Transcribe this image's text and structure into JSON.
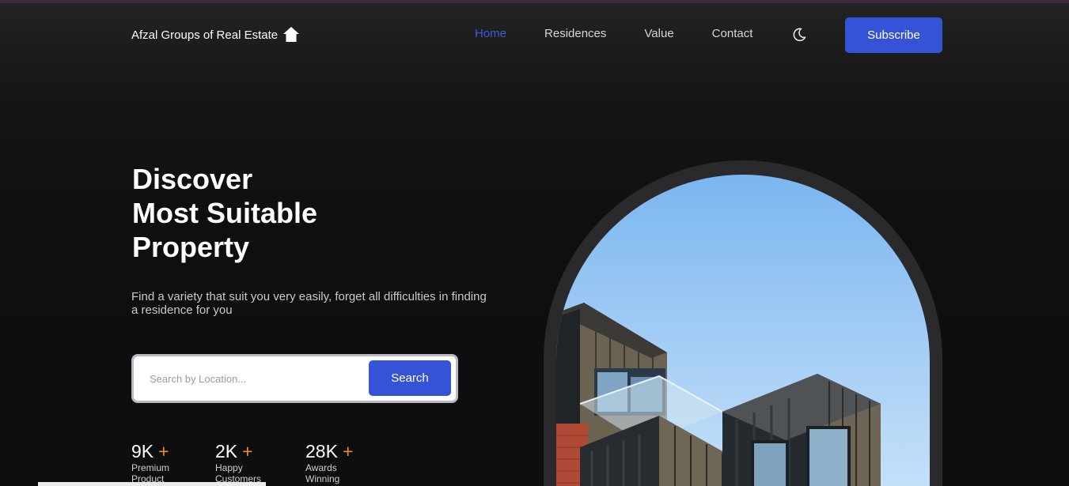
{
  "brand": {
    "name": "Afzal Groups of Real Estate",
    "icon": "home-icon"
  },
  "nav": {
    "items": [
      {
        "label": "Home",
        "active": true
      },
      {
        "label": "Residences",
        "active": false
      },
      {
        "label": "Value",
        "active": false
      },
      {
        "label": "Contact",
        "active": false
      }
    ],
    "theme_icon": "moon-icon",
    "subscribe_label": "Subscribe"
  },
  "hero": {
    "title_lines": [
      "Discover",
      "Most Suitable",
      "Property"
    ],
    "subtitle": "Find a variety that suit you very easily, forget all difficulties in finding a residence for you",
    "search": {
      "placeholder": "Search by Location...",
      "button_label": "Search"
    },
    "image_icon": "building-photo"
  },
  "stats": [
    {
      "value": "9K",
      "plus": "+",
      "label": "Premium Product"
    },
    {
      "value": "2K",
      "plus": "+",
      "label": "Happy Customers"
    },
    {
      "value": "28K",
      "plus": "+",
      "label": "Awards Winning"
    }
  ],
  "colors": {
    "accent": "#3553d6",
    "active_link": "#3d5bd9",
    "plus": "#ef8a2b",
    "background": "#0f0f10"
  }
}
